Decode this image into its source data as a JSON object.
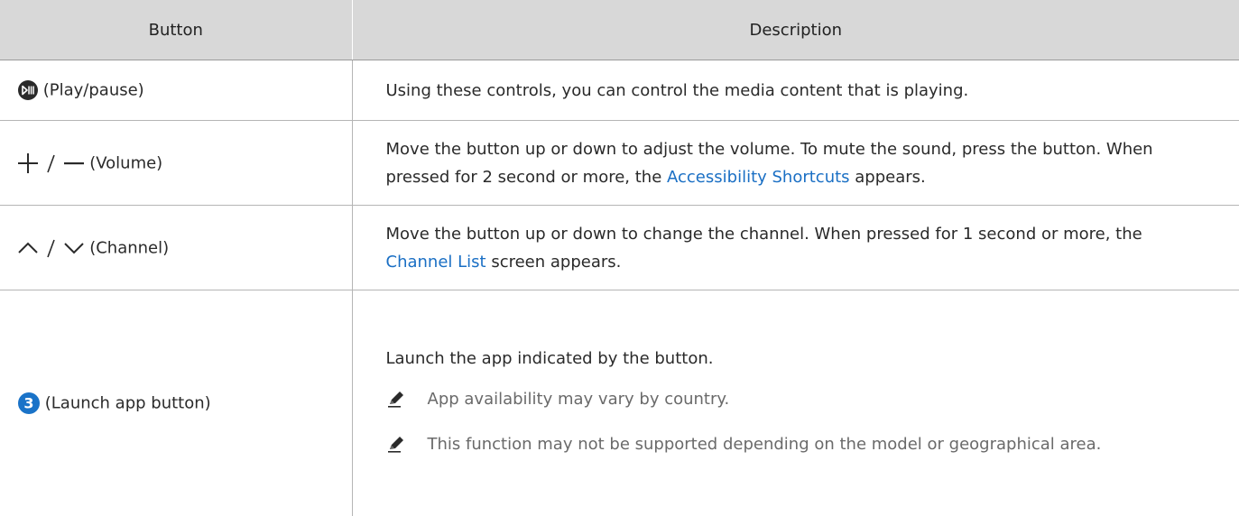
{
  "table": {
    "headers": [
      "Button",
      "Description"
    ],
    "rows": {
      "play": {
        "button_label": "(Play/pause)",
        "description": "Using these controls, you can control the media content that is playing."
      },
      "volume": {
        "button_label": "(Volume)",
        "desc_part1": "Move the button up or down to adjust the volume. To mute the sound, press the button. When pressed for 2 second or more, the ",
        "desc_highlight": "Accessibility Shortcuts",
        "desc_part2": " appears."
      },
      "channel": {
        "button_label": "(Channel)",
        "desc_part1": "Move the button up or down to change the channel. When pressed for 1 second or more, the ",
        "desc_highlight": "Channel List",
        "desc_part2": " screen appears."
      },
      "app": {
        "button_label": "(Launch app button)",
        "description": "Launch the app indicated by the button.",
        "notes": [
          "App availability may vary by country.",
          "This function may not be supported depending on the model or geographical area."
        ]
      }
    }
  },
  "icons": {
    "play": "play-pause-icon",
    "volume_up": "plus-icon",
    "volume_down": "minus-icon",
    "channel_up": "chevron-up-icon",
    "channel_down": "chevron-down-icon",
    "app": "app-number-3-icon",
    "note": "pencil-icon"
  },
  "colors": {
    "highlight": "#1a6fc4",
    "header_bg": "#d8d8d8",
    "app_icon": "#1a73c8"
  }
}
